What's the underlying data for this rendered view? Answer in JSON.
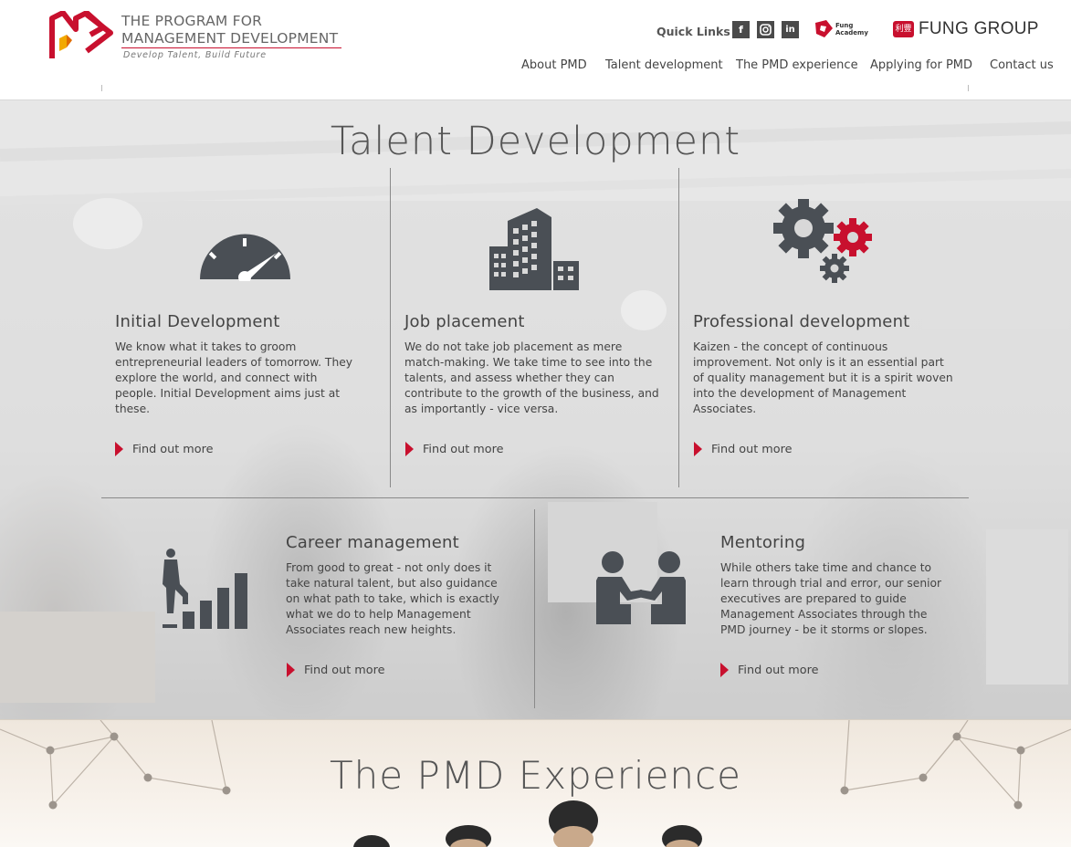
{
  "header": {
    "logo_title_line1": "THE  PROGRAM FOR",
    "logo_title_line2": "MANAGEMENT DEVELOPMENT",
    "logo_tagline": "Develop Talent, Build Future",
    "quick_links_label": "Quick Links",
    "social": [
      {
        "icon": "facebook-icon",
        "glyph": "f"
      },
      {
        "icon": "instagram-icon",
        "glyph": ""
      },
      {
        "icon": "linkedin-icon",
        "glyph": "in"
      }
    ],
    "fung_academy_line1": "Fung",
    "fung_academy_line2": "Academy",
    "fung_group_mark": "利豐",
    "fung_group_label": "FUNG GROUP",
    "brand_color": "#c8102e"
  },
  "nav": {
    "items": [
      "About PMD",
      "Talent development",
      "The PMD experience",
      "Applying for PMD",
      "Contact us"
    ]
  },
  "talent": {
    "title": "Talent Development",
    "find_more_label": "Find out more",
    "cards": [
      {
        "icon": "speedometer-icon",
        "title": "Initial Development",
        "text": "We know what it takes to groom entrepreneurial leaders of tomorrow. They explore the world, and connect with people. Initial Development aims just at these."
      },
      {
        "icon": "buildings-icon",
        "title": "Job placement",
        "text": "We do not take job placement as mere match-making. We take time to see into the talents, and assess whether they can contribute to the growth of the business, and as importantly - vice versa."
      },
      {
        "icon": "gears-icon",
        "title": "Professional development",
        "text": "Kaizen - the concept of continuous improvement. Not only is it an essential part of quality management but it is a spirit woven into the development of Management Associates."
      },
      {
        "icon": "career-steps-icon",
        "title": "Career management",
        "text": "From good to great - not only does it take natural talent, but also guidance on what path to take, which is exactly what we do to help Management Associates reach new heights."
      },
      {
        "icon": "mentoring-icon",
        "title": "Mentoring",
        "text": "While others take time and chance to learn through trial and error, our senior executives are prepared to guide Management Associates through the PMD journey - be it storms or slopes."
      }
    ]
  },
  "experience": {
    "title": "The PMD Experience"
  }
}
